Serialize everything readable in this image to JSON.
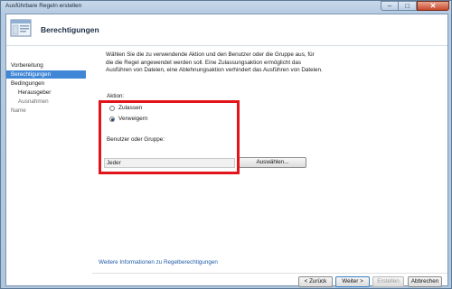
{
  "window": {
    "title": "Ausführbare Regeln erstellen",
    "icons": {
      "minimize": "minimize-icon",
      "maximize": "maximize-icon",
      "close": "close-icon"
    }
  },
  "header": {
    "title": "Berechtigungen",
    "icon": "wizard-page-icon"
  },
  "nav": {
    "items": [
      {
        "label": "Vorbereitung"
      },
      {
        "label": "Berechtigungen"
      },
      {
        "label": "Bedingungen"
      },
      {
        "label": "Herausgeber"
      },
      {
        "label": "Ausnahmen"
      },
      {
        "label": "Name"
      }
    ]
  },
  "main": {
    "intro": "Wählen Sie die zu verwendende Aktion und den Benutzer oder die Gruppe aus, für die die Regel angewendet werden soll. Eine Zulassungsaktion ermöglicht das Ausführen von Dateien, eine Ablehnungsaktion verhindert das Ausführen von Dateien.",
    "action_label": "Aktion:",
    "options": [
      {
        "label": "Zulassen",
        "checked": false
      },
      {
        "label": "Verweigern",
        "checked": true
      }
    ],
    "user_label": "Benutzer oder Gruppe:",
    "user_value": "Jeder",
    "select_button": "Auswählen...",
    "link": "Weitere Informationen zu Regelberechtigungen"
  },
  "footer": {
    "back": "< Zurück",
    "next": "Weiter >",
    "create": "Erstellen",
    "cancel": "Abbrechen"
  },
  "colors": {
    "highlight": "#e3131a",
    "selection": "#3f86d6",
    "link": "#1f5aa6"
  }
}
